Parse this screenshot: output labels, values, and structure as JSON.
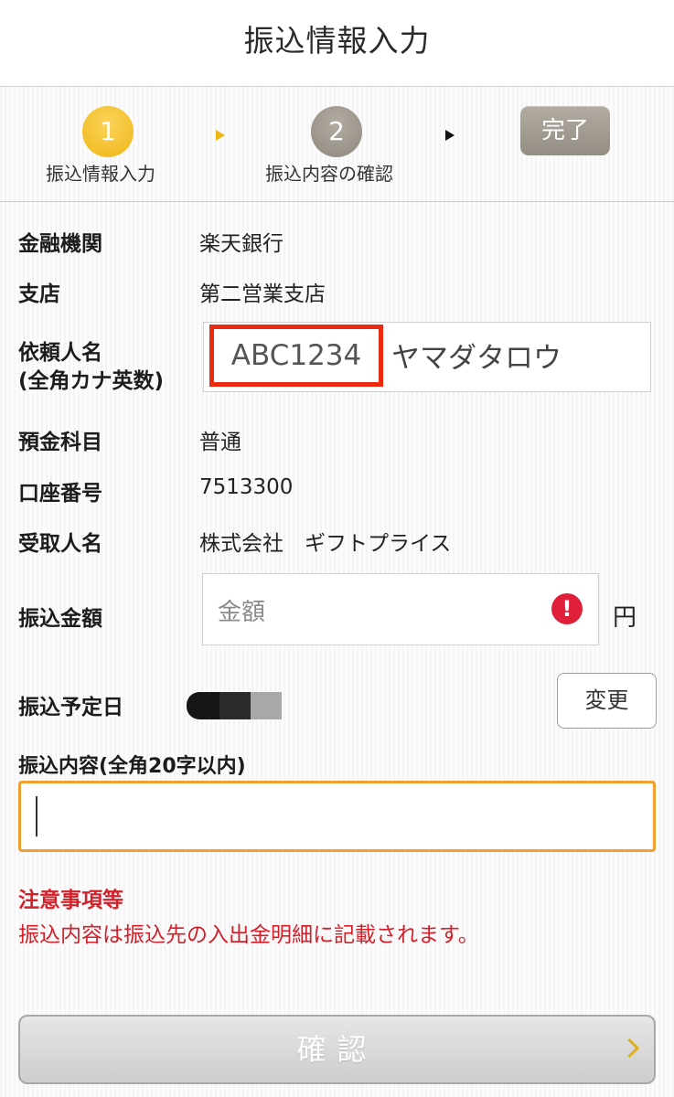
{
  "header": {
    "title": "振込情報入力"
  },
  "steps": [
    {
      "number": "1",
      "label": "振込情報入力",
      "state": "current"
    },
    {
      "number": "2",
      "label": "振込内容の確認",
      "state": "pending"
    },
    {
      "label": "完了",
      "state": "pending"
    }
  ],
  "form": {
    "bank": {
      "label": "金融機関",
      "value": "楽天銀行"
    },
    "branch": {
      "label": "支店",
      "value": "第二営業支店"
    },
    "requester": {
      "label": "依頼人名",
      "sublabel": "(全角カナ英数)",
      "id_value": "ABC1234",
      "name_value": "ヤマダタロウ"
    },
    "account_type": {
      "label": "預金科目",
      "value": "普通"
    },
    "account_number": {
      "label": "口座番号",
      "value": "7513300"
    },
    "recipient": {
      "label": "受取人名",
      "value": "株式会社　ギフトプライス"
    },
    "amount": {
      "label": "振込金額",
      "placeholder": "金額",
      "unit": "円",
      "error_icon": "exclamation-icon"
    },
    "date": {
      "label": "振込予定日",
      "change_label": "変更"
    },
    "memo": {
      "label": "振込内容(全角20字以内)",
      "value": ""
    }
  },
  "notes": {
    "title": "注意事項等",
    "text": "振込内容は振込先の入出金明細に記載されます。"
  },
  "confirm": {
    "label": "確認"
  },
  "colors": {
    "step_active": "#efb716",
    "step_inactive": "#948d83",
    "highlight_border": "#ec2a12",
    "focus_border": "#f0a033",
    "warning_text": "#d4202a",
    "error_icon": "#e0203a"
  }
}
